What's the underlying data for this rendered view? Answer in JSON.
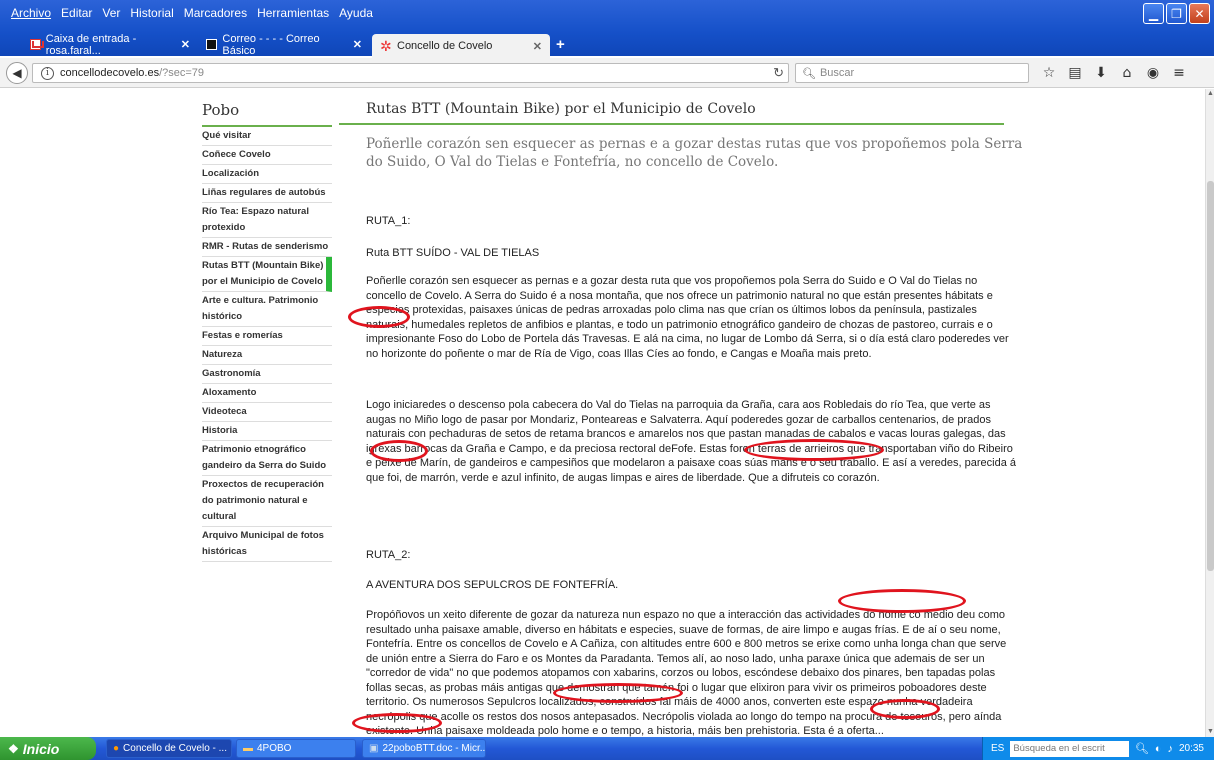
{
  "browser": {
    "menu": [
      "Archivo",
      "Editar",
      "Ver",
      "Historial",
      "Marcadores",
      "Herramientas",
      "Ayuda"
    ],
    "tabs": [
      {
        "label": "Caixa de entrada - rosa.faral...",
        "icon": "gmail-icon"
      },
      {
        "label": "Correo - - - - Correo Básico",
        "icon": "mail-icon"
      },
      {
        "label": "Concello de Covelo",
        "icon": "covelo-icon"
      }
    ],
    "url_host": "concellodecovelo.es",
    "url_path": "/?sec=79",
    "search_placeholder": "Buscar",
    "window_buttons": [
      "minimize",
      "restore",
      "close"
    ]
  },
  "sidebar": {
    "title": "Pobo",
    "items": [
      "Qué visitar",
      "Coñece Covelo",
      "Localización",
      "Liñas regulares de autobús",
      "Río Tea: Espazo natural protexido",
      "RMR - Rutas de senderismo",
      "Rutas BTT (Mountain Bike) por el Municipio de Covelo",
      "Arte e cultura. Patrimonio histórico",
      "Festas e romerías",
      "Natureza",
      "Gastronomía",
      "Aloxamento",
      "Videoteca",
      "Historia",
      "Patrimonio etnográfico gandeiro da Serra do Suido",
      "Proxectos de recuperación do patrimonio natural e cultural",
      "Arquivo Municipal de fotos históricas"
    ],
    "active_index": 6
  },
  "content": {
    "title": "Rutas BTT (Mountain Bike) por el Municipio de Covelo",
    "lead": "Poñerlle corazón sen esquecer as pernas e a gozar destas rutas que vos propoñemos pola Serra do Suido, O Val do Tielas e Fontefría, no concello de Covelo.",
    "ruta1_label": "RUTA_1:",
    "ruta1_title": "Ruta BTT SUÍDO - VAL DE TIELAS",
    "ruta1_p1": "Poñerlle corazón sen esquecer as pernas e a gozar desta ruta que vos propoñemos pola Serra do Suido e O Val do Tielas no concello de Covelo. A Serra do Suido é a nosa montaña, que nos ofrece un patrimonio natural no que están presentes hábitats e especies protexidas, paisaxes únicas de pedras arroxadas polo clima nas que crían os últimos lobos da península, pastizales naturais, humedales repletos de anfibios e plantas, e todo un patrimonio etnográfico gandeiro de chozas de pastoreo, currais e o impresionante Foso do Lobo de Portela dás Travesas. E alá na cima, no lugar de Lombo dá Serra, si o día está claro poderedes ver no horizonte do poñente o mar de Ría de Vigo, coas Illas Cíes ao fondo, e Cangas e Moaña mais preto.",
    "ruta1_p2": "Logo iniciaredes o descenso pola cabecera do Val do Tielas na parroquia da Graña, cara aos Robledais do río Tea, que verte as augas no Miño logo de pasar por Mondariz, Ponteareas e Salvaterra. Aquí poderedes gozar de carballos centenarios, de prados naturais con pechaduras de setos de retama brancos e amarelos nos que pastan manadas de cabalos e vacas louras galegas, das igrexas barrocas da Graña e Campo, e da preciosa rectoral deFofe. Estas foron terras de arrieiros que transportaban viño do Ribeiro e peixe de Marín, de gandeiros e campesiños que modelaron a paisaxe coas súas mans e o seu traballo. E así a veredes, parecida á que foi, de marrón, verde e azul infinito, de augas limpas e aires de liberdade. Que a difruteis co corazón.",
    "ruta2_label": "RUTA_2:",
    "ruta2_title": "A AVENTURA DOS SEPULCROS DE FONTEFRÍA.",
    "ruta2_p1": "Propóñovos un xeito diferente de gozar da natureza nun espazo no que a interacción das actividades do home co medio deu como resultado unha paisaxe amable, diverso en hábitats e especies, suave de formas, de aire limpo e augas frías. E de aí o seu nome, Fontefría. Entre os concellos de Covelo e A Cañiza, con altitudes entre 600 e 800 metros se erixe como unha longa chan que serve de unión entre a Sierra do Faro e os Montes da Paradanta. Temos alí, ao noso lado, unha paraxe única que ademais de ser un \"corredor de vida\" no que podemos atopamos con xabarins, corzos ou lobos, escóndese debaixo dos pinares, ben tapadas polas follas secas, as probas máis antigas que demostran que tamén foi o lugar que elixiron para vivir os primeiros poboadores deste territorio. Os numerosos Sepulcros localizados, construídos fai máis de 4000 anos, converten este espazo nunha verdadeira necrópolis que acolle os restos dos nosos antepasados. Necrópolis violada ao longo do tempo na procura de tesouros, pero aínda existente. Unha paisaxe moldeada polo home e o tempo, a historia, máis ben prehistoria. Esta é a oferta..."
  },
  "taskbar": {
    "start_label": "Inicio",
    "tasks": [
      {
        "label": "Concello de Covelo - ...",
        "icon": "firefox-icon"
      },
      {
        "label": "4POBO",
        "icon": "folder-icon"
      },
      {
        "label": "22poboBTT.doc - Micr...",
        "icon": "word-icon"
      }
    ],
    "lang": "ES",
    "search_placeholder": "Búsqueda en el escrit",
    "time": "20:35"
  }
}
